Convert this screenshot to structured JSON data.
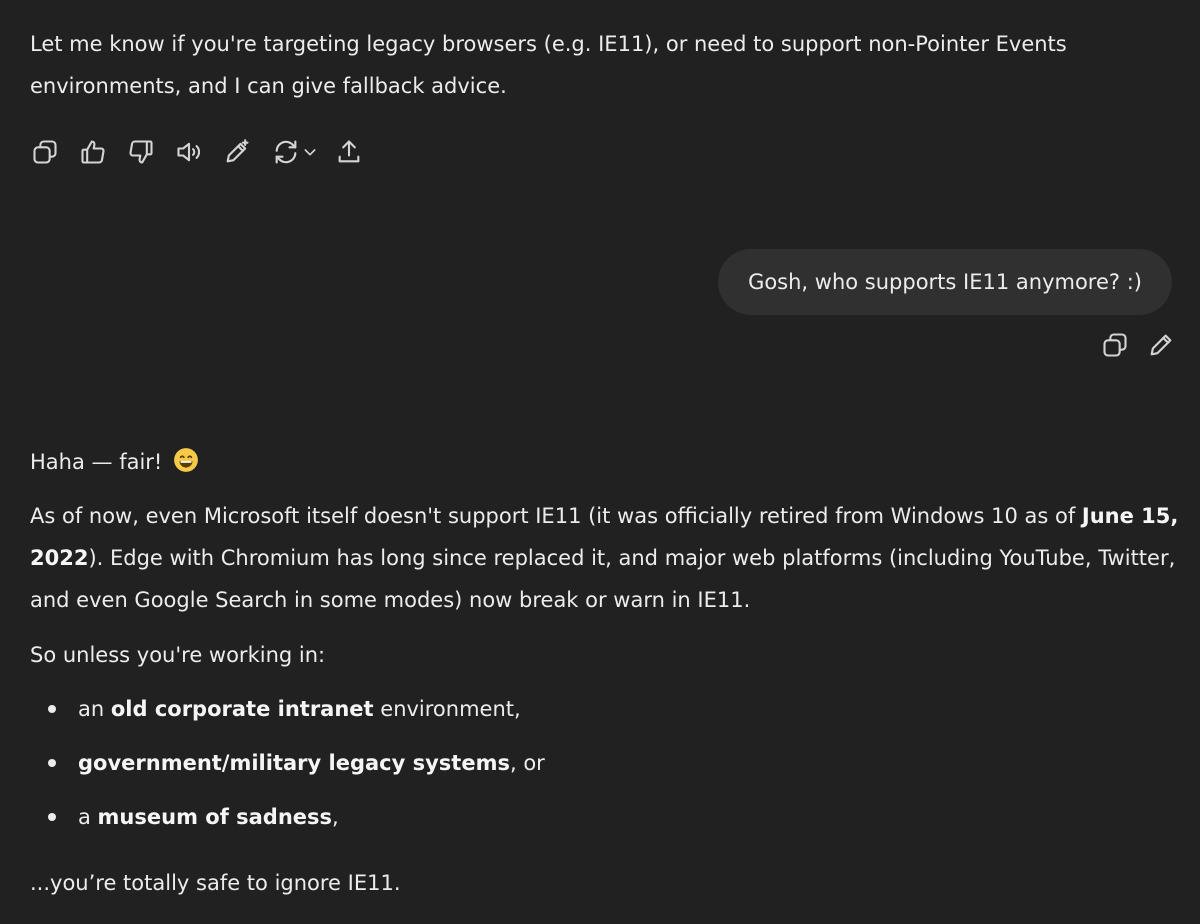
{
  "assistant_message_1": {
    "text": "Let me know if you're targeting legacy browsers (e.g. IE11), or need to support non-Pointer Events environments, and I can give fallback advice."
  },
  "message_toolbar": {
    "icons": [
      "copy-icon",
      "thumbs-up-icon",
      "thumbs-down-icon",
      "read-aloud-icon",
      "edit-in-canvas-icon",
      "regenerate-icon",
      "chevron-down-icon",
      "share-icon"
    ]
  },
  "user_message": {
    "text": "Gosh, who supports IE11 anymore? :)",
    "icons": [
      "copy-icon",
      "edit-icon"
    ]
  },
  "assistant_message_2": {
    "greeting": "Haha — fair!",
    "greeting_emoji": "grinning-face-emoji",
    "para1_prefix": "As of now, even Microsoft itself doesn't support IE11 (it was officially retired from Windows 10 as of ",
    "para1_bold": "June 15, 2022",
    "para1_suffix": "). Edge with Chromium has long since replaced it, and major web platforms (including YouTube, Twitter, and even Google Search in some modes) now break or warn in IE11.",
    "para2": "So unless you're working in:",
    "bullets": [
      {
        "prefix": "an ",
        "bold": "old corporate intranet",
        "suffix": " environment,"
      },
      {
        "prefix": "",
        "bold": "government/military legacy systems",
        "suffix": ", or"
      },
      {
        "prefix": "a ",
        "bold": "museum of sadness",
        "suffix": ","
      }
    ],
    "closing": "...you’re totally safe to ignore IE11."
  },
  "colors": {
    "background": "#212121",
    "text": "#ececec",
    "bubble": "#303030",
    "emoji": "#f7c948"
  }
}
